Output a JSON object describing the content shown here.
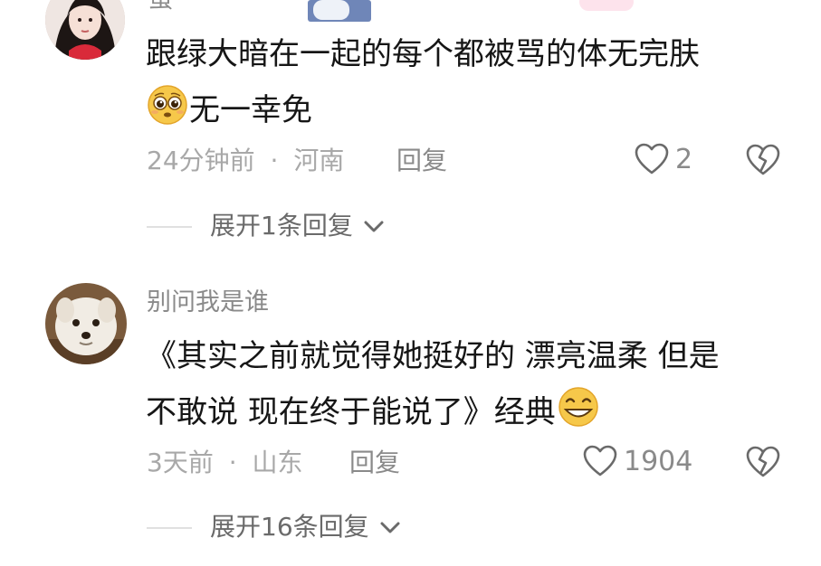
{
  "comments": [
    {
      "username": "蛋",
      "avatar_icon": "girl-avatar",
      "text_line1": "跟绿大暗在一起的每个都被骂的体无完肤",
      "emoji1": "pleading-face-emoji",
      "text_line2": "无一幸免",
      "time": "24分钟前",
      "separator": "·",
      "location": "河南",
      "reply_label": "回复",
      "like_count": "2",
      "expand_label": "展开1条回复"
    },
    {
      "username": "别问我是谁",
      "avatar_icon": "white-dog-avatar",
      "text_line1": "《其实之前就觉得她挺好的 漂亮温柔 但是",
      "text_line2": "不敢说 现在终于能说了》经典",
      "emoji2": "grinning-face-emoji",
      "time": "3天前",
      "separator": "·",
      "location": "山东",
      "reply_label": "回复",
      "like_count": "1904",
      "expand_label": "展开16条回复"
    }
  ],
  "colors": {
    "text": "#161616",
    "meta": "#a8a8a8",
    "icon": "#6a6a6a"
  }
}
